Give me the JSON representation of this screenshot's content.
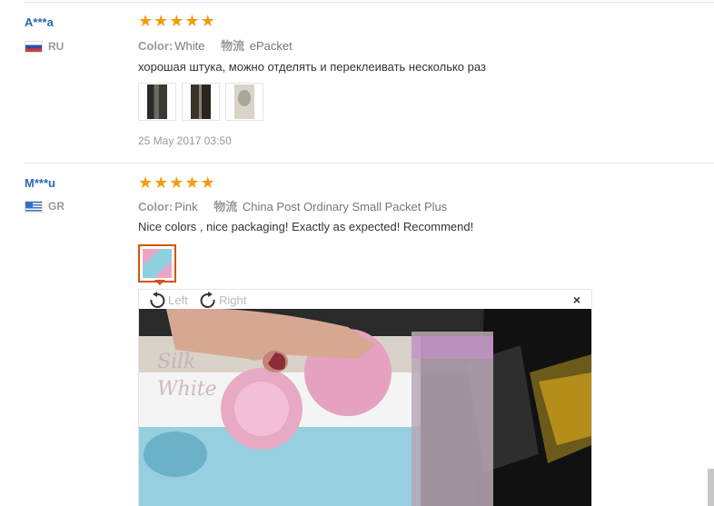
{
  "reviews": [
    {
      "user": "A***a",
      "country": "RU",
      "stars": [
        "★",
        "★",
        "★",
        "★",
        "★"
      ],
      "color_label": "Color:",
      "color_value": "White",
      "shipping_label": "物流",
      "shipping_value": "ePacket",
      "comment": "хорошая штука, можно отделять и переклеивать несколько раз",
      "date": "25 May 2017 03:50"
    },
    {
      "user": "M***u",
      "country": "GR",
      "stars": [
        "★",
        "★",
        "★",
        "★",
        "★"
      ],
      "color_label": "Color:",
      "color_value": "Pink",
      "shipping_label": "物流",
      "shipping_value": "China Post Ordinary Small Packet Plus",
      "comment": "Nice colors , nice packaging! Exactly as expected! Recommend!"
    }
  ],
  "viewer": {
    "rotate_left": "Left",
    "rotate_right": "Right",
    "close": "×"
  },
  "colors": {
    "star": "#f39c12",
    "username": "#2a67b8",
    "active_thumb_border": "#d35400"
  }
}
